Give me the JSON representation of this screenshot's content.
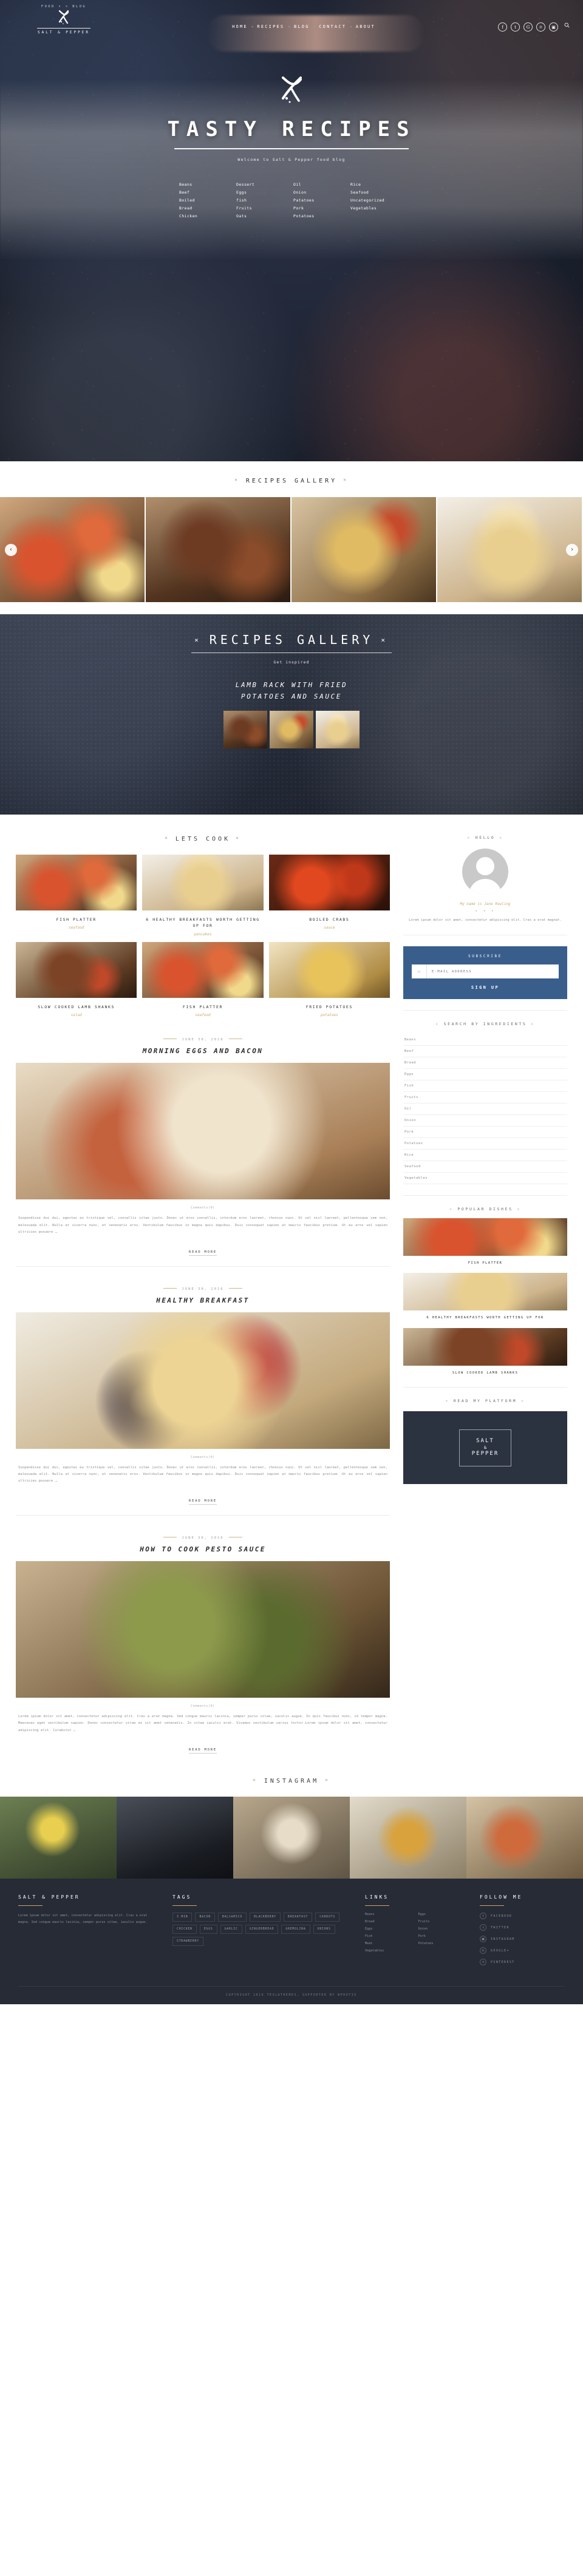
{
  "brand": {
    "top_tagline": "FOOD × × BLOG",
    "name": "SALT & PEPPER",
    "logo_icon": "whisk-logo-icon"
  },
  "nav": {
    "items": [
      "HOME",
      "RECIPES",
      "BLOG",
      "CONTACT",
      "ABOUT"
    ],
    "separator": "×",
    "socials": [
      {
        "name": "facebook-icon",
        "glyph": "f"
      },
      {
        "name": "twitter-icon",
        "glyph": "t"
      },
      {
        "name": "google-plus-icon",
        "glyph": "G"
      },
      {
        "name": "pinterest-icon",
        "glyph": "℗"
      },
      {
        "name": "instagram-icon",
        "glyph": "▣"
      }
    ],
    "search_icon": "search-icon"
  },
  "hero": {
    "title": "TASTY RECIPES",
    "subtitle": "Welcome to Salt & Pepper food blog",
    "categories": [
      [
        "Beans",
        "Beef",
        "Boiled",
        "Bread",
        "Chicken"
      ],
      [
        "Dessert",
        "Eggs",
        "fish",
        "Fruits",
        "Oats"
      ],
      [
        "Oil",
        "Onion",
        "Patatoes",
        "Pork",
        "Potatoes"
      ],
      [
        "Rice",
        "Seafood",
        "Uncategorized",
        "Vegetables"
      ]
    ]
  },
  "gallery_section": {
    "heading": "RECIPES GALLERY",
    "marker": "×",
    "prev_label": "‹",
    "next_label": "›",
    "slides": [
      "ph-lobster",
      "ph-meat",
      "ph-pasta",
      "ph-pancake"
    ]
  },
  "dark_gallery": {
    "heading": "RECIPES GALLERY",
    "marker": "×",
    "subtitle": "Get inspired",
    "recipe_title": "LAMB RACK WITH FRIED\nPOTATOES AND SAUCE",
    "recipe_line1": "LAMB RACK WITH FRIED",
    "recipe_line2": "POTATOES AND SAUCE"
  },
  "lets_cook": {
    "heading": "LETS COOK",
    "marker": "×",
    "cards": [
      {
        "title": "FISH PLATTER",
        "category": "seafood",
        "img": "ph-lobster"
      },
      {
        "title": "6 HEALTHY BREAKFASTS WORTH GETTING UP FOR",
        "category": "pancakes",
        "img": "ph-pancake"
      },
      {
        "title": "BOILED CRABS",
        "category": "sauce",
        "img": "ph-crab"
      },
      {
        "title": "SLOW COOKED LAMB SHANKS",
        "category": "salad",
        "img": "ph-lamb"
      },
      {
        "title": "FISH PLATTER",
        "category": "seafood",
        "img": "ph-lobster"
      },
      {
        "title": "FRIED POTATOES",
        "category": "potatoes",
        "img": "ph-fries"
      }
    ]
  },
  "posts": [
    {
      "date": "JUNE 30, 2016",
      "title": "MORNING EGGS AND BACON",
      "img": "ph-eggs",
      "comments": "Comments(0)",
      "body": "Suspendisse dui dui, egestas eu tristique vel, convallis vitae justo. Donec ut eros convallis, interdum eros laoreet, rhoncus nunc. Ut vel nisl laoreet, pellentesque sem non, malesuada elit. Nulla at viverra nunc, et venenatis eros. Vestibulum faucibus in magna quis dapibus. Duis consequat sapien at mauris faucibus pretium. Ut eu eros vel sapien ultricies posuere …",
      "read_more": "READ MORE"
    },
    {
      "date": "JUNE 30, 2016",
      "title": "HEALTHY BREAKFAST",
      "img": "ph-berry",
      "comments": "Comments(0)",
      "body": "Suspendisse dui dui, egestas eu tristique vel, convallis vitae justo. Donec ut eros convallis, interdum eros laoreet, rhoncus nunc. Ut vel nisl laoreet, pellentesque sem non, malesuada elit. Nulla at viverra nunc, et venenatis eros. Vestibulum faucibus in magna quis dapibus. Duis consequat sapien at mauris faucibus pretium. Ut eu eros vel sapien ultricies posuere …",
      "read_more": "READ MORE"
    },
    {
      "date": "JUNE 30, 2016",
      "title": "HOW TO COOK PESTO SAUCE",
      "img": "ph-pesto",
      "comments": "Comments(0)",
      "body": "Lorem ipsum dolor sit amet, consectetur adipiscing elit. Cras a erat magna. Sed congue mauris lacinia, semper purus vitae, iaculis augue. In quis faucibus nunc, id tempor magna. Maecenas eget vestibulum sapien. Donec consectetur vitae ex sit amet venenatis. In vitae iaculis erat. Vivamus vestibulum varius tortor.Lorem ipsum dolor sit amet, consectetur adipiscing elit. Curabitur …",
      "read_more": "READ MORE"
    }
  ],
  "sidebar": {
    "hello": {
      "heading": "HELLO",
      "marker": "×",
      "avatar": "avatar-placeholder-icon",
      "name": "My name is Jane Rowling",
      "dots": "• • •",
      "text": "Lorem ipsum dolor sit amet, consectetur adipiscing elit. Cras a erat magnat."
    },
    "subscribe": {
      "title": "SUBSCRIBE",
      "email_placeholder": "E-MAIL ADDRESS",
      "email_value": "",
      "mail_icon": "envelope-icon",
      "button": "SIGN UP"
    },
    "search_ingredients": {
      "heading": "SEARCH BY INGREDIENTS",
      "marker": "×",
      "items": [
        "Beans",
        "Beef",
        "Bread",
        "Eggs",
        "Fish",
        "Fruits",
        "Oil",
        "Onion",
        "Pork",
        "Potatoes",
        "Rice",
        "Seafood",
        "Vegetables"
      ]
    },
    "popular": {
      "heading": "POPULAR DISHES",
      "marker": "×",
      "items": [
        {
          "title": "FISH PLATTER",
          "img": "ph-lobster"
        },
        {
          "title": "6 HEALTHY BREAKFASTS WORTH GETTING UP FOR",
          "img": "ph-pancake"
        },
        {
          "title": "SLOW COOKED LAMB SHANKS",
          "img": "ph-lamb"
        }
      ]
    },
    "ad": {
      "heading": "READ MY PLATFORM",
      "marker": "×",
      "line1": "SALT",
      "amp": "&",
      "line2": "PEPPER"
    }
  },
  "instagram": {
    "heading": "INSTAGRAM",
    "marker": "×",
    "cells": [
      "ig1",
      "ig2",
      "ig3",
      "ig4",
      "ig5"
    ]
  },
  "footer": {
    "brand_title": "SALT & PEPPER",
    "brand_text": "Lorem ipsum dolor sit amet, consectetur adipiscing elit. Cras a erat magna. Sed congue mauris lacinia, semper purus vitae, iaculis augue.",
    "tags_title": "TAGS",
    "tags": [
      "3 MIN",
      "BACON",
      "BALSAMICO",
      "BLACKBERRY",
      "BREAKFAST",
      "CARROTS",
      "CHICKEN",
      "EGGS",
      "GARLIC",
      "GINGERBREAD",
      "GREMOLINA",
      "ONIONS",
      "STRAWBERRY"
    ],
    "links_title": "LINKS",
    "links": [
      "Beans",
      "Eggs",
      "Bread",
      "Fruits",
      "Eggs",
      "Onion",
      "Fish",
      "Pork",
      "Meat",
      "Potatoes",
      "Vegetables"
    ],
    "follow_title": "FOLLOW ME",
    "follow": [
      {
        "icon": "facebook-icon",
        "glyph": "f",
        "label": "FACEBOOK"
      },
      {
        "icon": "twitter-icon",
        "glyph": "t",
        "label": "TWITTER"
      },
      {
        "icon": "instagram-icon",
        "glyph": "▣",
        "label": "INSTAGRAM"
      },
      {
        "icon": "google-plus-icon",
        "glyph": "G",
        "label": "GOOGLE+"
      },
      {
        "icon": "pinterest-icon",
        "glyph": "℗",
        "label": "PINTEREST"
      }
    ],
    "copyright": "COPYRIGHT 2016 TESLATHEMES, SUPPORTED BY WPHOTIX"
  }
}
